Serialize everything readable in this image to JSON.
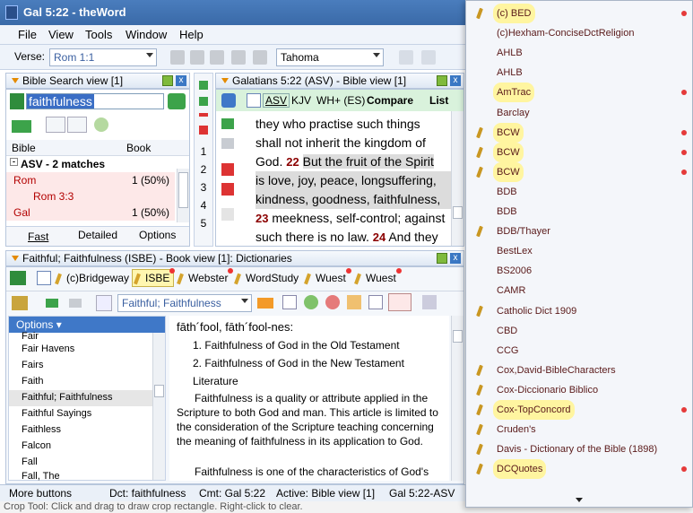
{
  "window": {
    "title": "Gal 5:22 - theWord"
  },
  "menu": [
    "File",
    "View",
    "Tools",
    "Window",
    "Help"
  ],
  "toolbar": {
    "verse_label": "Verse:",
    "verse_value": "Rom 1:1",
    "font_value": "Tahoma"
  },
  "search_pane": {
    "title": "Bible Search view [1]",
    "query": "faithfulness",
    "col_bible": "Bible",
    "col_book": "Book",
    "group": "ASV - 2 matches",
    "rows": [
      {
        "name": "Rom",
        "count": "1 (50%)"
      },
      {
        "name": "Rom 3:3",
        "count": ""
      },
      {
        "name": "Gal",
        "count": "1 (50%)"
      }
    ],
    "tabs": [
      "Fast",
      "Detailed",
      "Options"
    ]
  },
  "bible_pane": {
    "title": "Galatians 5:22 (ASV) - Bible view [1]",
    "versions": [
      "ASV",
      "KJV",
      "WH+ (ES)",
      "Compare",
      "List"
    ],
    "gutter": [
      "1",
      "2",
      "3",
      "4",
      "5"
    ],
    "line1": "they who practise such things",
    "line2": "shall not inherit the kingdom of",
    "line3a": "God.",
    "v22": "22",
    "line3b": "But the fruit of the Spirit",
    "line4": "is love, joy, peace, longsuffering,",
    "line5": "kindness, goodness, faithfulness,",
    "v23": "23",
    "line6": "meekness, self-control; against",
    "line7a": "such there is no law.",
    "v24": "24",
    "line7b": "And they"
  },
  "dict_pane": {
    "title": "Faithful; Faithfulness (ISBE) - Book view [1]: Dictionaries",
    "tabs": [
      "(c)Bridgeway",
      "ISBE",
      "Webster",
      "WordStudy",
      "Wuest",
      "Wuest"
    ],
    "topic": "Faithful; Faithfulness",
    "options_label": "Options",
    "list": [
      "Fair",
      "Fair Havens",
      "Fairs",
      "Faith",
      "Faithful; Faithfulness",
      "Faithful Sayings",
      "Faithless",
      "Falcon",
      "Fall",
      "Fall, The"
    ],
    "pron": "fāth´fool, fāth´fool-nes:",
    "outline": [
      "1.   Faithfulness of God in the Old Testament",
      "2.   Faithfulness of God in the New Testament",
      "Literature"
    ],
    "para1": "Faithfulness is a quality or attribute applied in the Scripture to both God and man. This article is limited to the consideration of the Scripture teaching concerning the meaning of faithfulness in its application to God.",
    "para2": "Faithfulness is one of the characteristics of God's"
  },
  "status": {
    "more": "More buttons",
    "dct": "Dct: faithfulness",
    "cmt": "Cmt: Gal 5:22",
    "active": "Active: Bible view [1]",
    "ref": "Gal 5:22-ASV"
  },
  "hint": "Crop Tool: Click and drag to draw crop rectangle. Right-click to clear.",
  "dropdown": {
    "items": [
      {
        "label": "(c) BED",
        "pen": true,
        "yellow": true,
        "dot": true
      },
      {
        "label": "(c)Hexham-ConciseDctReligion",
        "pen": false,
        "yellow": false,
        "dot": false
      },
      {
        "label": "AHLB",
        "pen": false,
        "yellow": false,
        "dot": false
      },
      {
        "label": "AHLB",
        "pen": false,
        "yellow": false,
        "dot": false
      },
      {
        "label": "AmTrac",
        "pen": false,
        "yellow": true,
        "dot": true
      },
      {
        "label": "Barclay",
        "pen": false,
        "yellow": false,
        "dot": false
      },
      {
        "label": "BCW",
        "pen": true,
        "yellow": true,
        "dot": true
      },
      {
        "label": "BCW",
        "pen": true,
        "yellow": true,
        "dot": true
      },
      {
        "label": "BCW",
        "pen": true,
        "yellow": true,
        "dot": true
      },
      {
        "label": "BDB",
        "pen": false,
        "yellow": false,
        "dot": false
      },
      {
        "label": "BDB",
        "pen": false,
        "yellow": false,
        "dot": false
      },
      {
        "label": "BDB/Thayer",
        "pen": true,
        "yellow": false,
        "dot": false
      },
      {
        "label": "BestLex",
        "pen": false,
        "yellow": false,
        "dot": false
      },
      {
        "label": "BS2006",
        "pen": false,
        "yellow": false,
        "dot": false
      },
      {
        "label": "CAMR",
        "pen": false,
        "yellow": false,
        "dot": false
      },
      {
        "label": "Catholic Dict 1909",
        "pen": true,
        "yellow": false,
        "dot": false
      },
      {
        "label": "CBD",
        "pen": false,
        "yellow": false,
        "dot": false
      },
      {
        "label": "CCG",
        "pen": false,
        "yellow": false,
        "dot": false
      },
      {
        "label": "Cox,David-BibleCharacters",
        "pen": true,
        "yellow": false,
        "dot": false
      },
      {
        "label": "Cox-Diccionario Biblico",
        "pen": true,
        "yellow": false,
        "dot": false
      },
      {
        "label": "Cox-TopConcord",
        "pen": true,
        "yellow": true,
        "dot": true
      },
      {
        "label": "Cruden's",
        "pen": true,
        "yellow": false,
        "dot": false
      },
      {
        "label": "Davis - Dictionary of the Bible (1898)",
        "pen": true,
        "yellow": false,
        "dot": false
      },
      {
        "label": "DCQuotes",
        "pen": true,
        "yellow": true,
        "dot": true
      }
    ]
  }
}
